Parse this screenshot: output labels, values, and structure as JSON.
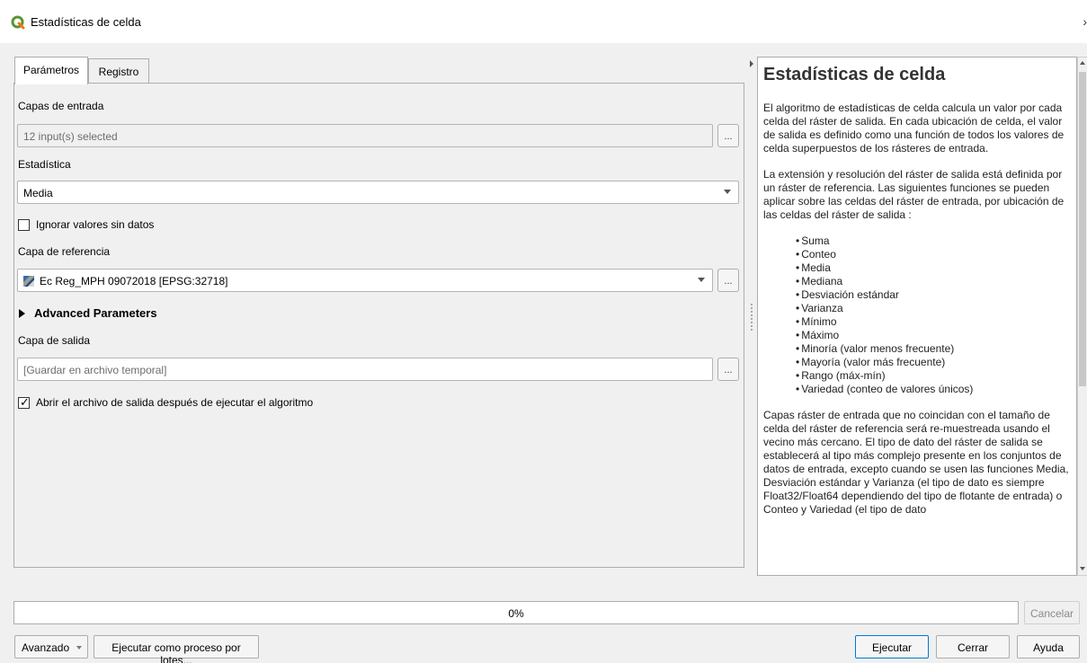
{
  "window": {
    "title": "Estadísticas de celda",
    "close_glyph": "›"
  },
  "tabs": [
    {
      "label": "Parámetros",
      "active": true
    },
    {
      "label": "Registro",
      "active": false
    }
  ],
  "params": {
    "input_layers_label": "Capas de entrada",
    "input_layers_value": "12 input(s) selected",
    "statistic_label": "Estadística",
    "statistic_value": "Media",
    "ignore_nodata_label": "Ignorar valores sin datos",
    "ignore_nodata_checked": false,
    "reference_layer_label": "Capa de referencia",
    "reference_layer_value": "Ec Reg_MPH 09072018 [EPSG:32718]",
    "advanced_label": "Advanced Parameters",
    "output_label": "Capa de salida",
    "output_placeholder": "[Guardar en archivo temporal]",
    "open_output_label": "Abrir el archivo de salida después de ejecutar el algoritmo",
    "open_output_checked": true,
    "dots_label": "...",
    "dots_menu_label": "..."
  },
  "help": {
    "title": "Estadísticas de celda",
    "p1": "El algoritmo de estadísticas de celda calcula un valor por cada celda del ráster de salida. En cada ubicación de celda, el valor de salida es definido como una función de todos los valores de celda superpuestos de los rásteres de entrada.",
    "p2": "La extensión y resolución del ráster de salida está definida por un ráster de referencia. Las siguientes funciones se pueden aplicar sobre las celdas del ráster de entrada, por ubicación de las celdas del ráster de salida :",
    "functions": [
      "Suma",
      "Conteo",
      "Media",
      "Mediana",
      "Desviación estándar",
      "Varianza",
      "Mínimo",
      "Máximo",
      "Minoría (valor menos frecuente)",
      "Mayoría (valor más frecuente)",
      "Rango (máx-mín)",
      "Variedad (conteo de valores únicos)"
    ],
    "p3": "Capas ráster de entrada que no coincidan con el tamaño de celda del ráster de referencia será re-muestreada usando el vecino más cercano. El tipo de dato del ráster de salida se establecerá al tipo más complejo presente en los conjuntos de datos de entrada, excepto cuando se usen las funciones Media, Desviación estándar y Varianza (el tipo de dato es siempre Float32/Float64 dependiendo del tipo de flotante de entrada) o Conteo y Variedad (el tipo de dato"
  },
  "progress": {
    "percent_label": "0%",
    "value": 0
  },
  "buttons": {
    "cancel": "Cancelar",
    "advanced": "Avanzado",
    "batch": "Ejecutar como proceso por lotes...",
    "run": "Ejecutar",
    "close": "Cerrar",
    "help": "Ayuda"
  },
  "colors": {
    "progress_fill": "#06b025",
    "default_button_border": "#0078d7"
  }
}
